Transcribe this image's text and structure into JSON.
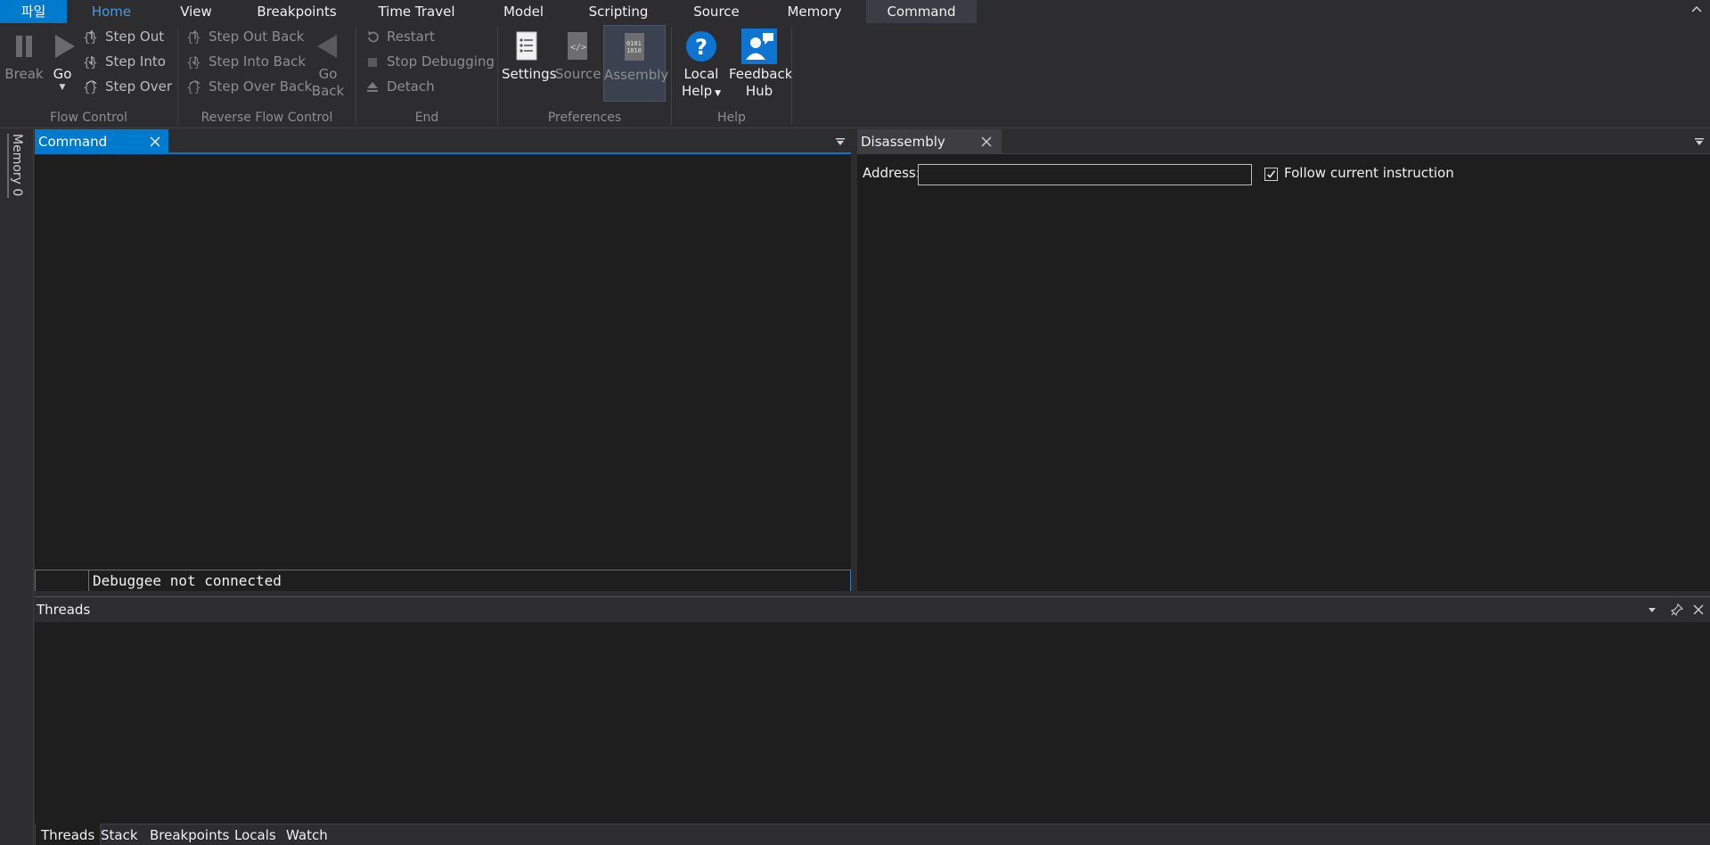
{
  "ribbon_tabs": {
    "file": "파일",
    "home": "Home",
    "view": "View",
    "breakpoints": "Breakpoints",
    "time_travel": "Time Travel",
    "model": "Model",
    "scripting": "Scripting",
    "source": "Source",
    "memory": "Memory",
    "command": "Command"
  },
  "flow_control": {
    "break": "Break",
    "go": "Go",
    "step_out": "Step Out",
    "step_into": "Step Into",
    "step_over": "Step Over",
    "label": "Flow Control"
  },
  "reverse_flow_control": {
    "step_out_back": "Step Out Back",
    "step_into_back": "Step Into Back",
    "step_over_back": "Step Over Back",
    "go_back_1": "Go",
    "go_back_2": "Back",
    "label": "Reverse Flow Control"
  },
  "end": {
    "restart": "Restart",
    "stop_debugging": "Stop Debugging",
    "detach": "Detach",
    "label": "End"
  },
  "preferences": {
    "settings": "Settings",
    "source": "Source",
    "assembly": "Assembly",
    "label": "Preferences"
  },
  "help": {
    "local_help_1": "Local",
    "local_help_2": "Help",
    "feedback_hub_1": "Feedback",
    "feedback_hub_2": "Hub",
    "label": "Help"
  },
  "left_strip": {
    "memory0": "Memory 0"
  },
  "command_pane": {
    "tab": "Command",
    "input_text": "Debuggee not connected"
  },
  "disassembly_pane": {
    "tab": "Disassembly",
    "address_label": "Address:",
    "address_value": "",
    "follow_label": "Follow current instruction",
    "follow_checked": true
  },
  "threads_pane": {
    "title": "Threads",
    "bottom_tabs": [
      "Threads",
      "Stack",
      "Breakpoints",
      "Locals",
      "Watch"
    ]
  },
  "colors": {
    "accent": "#007acc",
    "background": "#1e1e1e",
    "chrome": "#2d2d30"
  }
}
